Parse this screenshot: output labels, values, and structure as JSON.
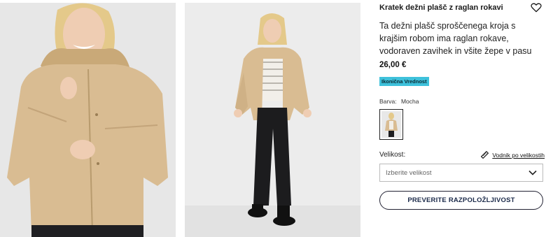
{
  "product": {
    "title": "Kratek dežni plašč z raglan rokavi",
    "description": "Ta dežni plašč sproščenega kroja s krajšim robom ima raglan rokave, vodoraven zavihek in všite žepe v pasu",
    "price": "26,00 €",
    "badge": "Ikonična Vrednost",
    "color_label": "Barva:",
    "color_value": "Mocha",
    "size_label": "Velikost:",
    "size_guide": "Vodnik po velikostih",
    "size_placeholder": "Izberite velikost",
    "cta": "PREVERITE RAZPOLOŽLJIVOST"
  },
  "icons": {
    "favorite": "heart-icon",
    "size_guide": "ruler-icon",
    "dropdown": "chevron-down-icon"
  },
  "colors": {
    "badge_bg": "#3ec1db",
    "coat": "#d9bc92",
    "pants": "#1c1c1e",
    "cta_text": "#1b2a4a"
  }
}
